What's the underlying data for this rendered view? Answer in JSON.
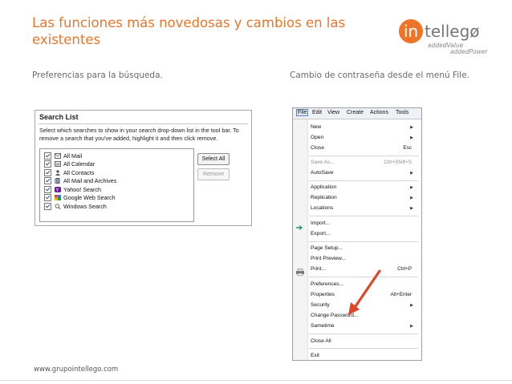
{
  "title": "Las funciones más novedosas y cambios en las existentes",
  "logo": {
    "word": "intellego",
    "tag1": "addedValue",
    "tag2": "addedPower",
    "brand_color": "#ee7428"
  },
  "captions": {
    "left": "Preferencias para la búsqueda.",
    "right": "Cambio de contraseña desde el menú File."
  },
  "footer": "www.grupointellego.com",
  "search_list": {
    "title": "Search List",
    "description": "Select which searches to show in your search drop-down list in the tool bar. To remove a search that you've added, highlight it and then click remove.",
    "items": [
      {
        "label": "All Mail",
        "icon": "mail-icon",
        "checked": true
      },
      {
        "label": "All Calendar",
        "icon": "calendar-icon",
        "checked": true
      },
      {
        "label": "All Contacts",
        "icon": "contacts-icon",
        "checked": true
      },
      {
        "label": "All Mail and Archives",
        "icon": "archive-icon",
        "checked": true
      },
      {
        "label": "Yahoo! Search",
        "icon": "yahoo-icon",
        "checked": true
      },
      {
        "label": "Google Web Search",
        "icon": "google-icon",
        "checked": true
      },
      {
        "label": "Windows Search",
        "icon": "magnifier-icon",
        "checked": true
      }
    ],
    "select_all": "Select All",
    "remove": "Remove"
  },
  "file_menu": {
    "menubar": [
      "File",
      "Edit",
      "View",
      "Create",
      "Actions",
      "Tools"
    ],
    "items": [
      {
        "label": "New",
        "shortcut": "",
        "submenu": true,
        "disabled": false
      },
      {
        "label": "Open",
        "shortcut": "",
        "submenu": true,
        "disabled": false
      },
      {
        "label": "Close",
        "shortcut": "Esc",
        "submenu": false,
        "disabled": false
      },
      {
        "label": "Save As...",
        "shortcut": "Ctrl+Shift+S",
        "submenu": false,
        "disabled": true
      },
      {
        "label": "AutoSave",
        "shortcut": "",
        "submenu": true,
        "disabled": false
      },
      {
        "label": "Application",
        "shortcut": "",
        "submenu": true,
        "disabled": false
      },
      {
        "label": "Replication",
        "shortcut": "",
        "submenu": true,
        "disabled": false
      },
      {
        "label": "Locations",
        "shortcut": "",
        "submenu": true,
        "disabled": false
      },
      {
        "label": "Import...",
        "shortcut": "",
        "submenu": false,
        "disabled": false
      },
      {
        "label": "Export...",
        "shortcut": "",
        "submenu": false,
        "disabled": false
      },
      {
        "label": "Page Setup...",
        "shortcut": "",
        "submenu": false,
        "disabled": false
      },
      {
        "label": "Print Preview...",
        "shortcut": "",
        "submenu": false,
        "disabled": false
      },
      {
        "label": "Print...",
        "shortcut": "Ctrl+P",
        "submenu": false,
        "disabled": false
      },
      {
        "label": "Preferences...",
        "shortcut": "",
        "submenu": false,
        "disabled": false
      },
      {
        "label": "Properties",
        "shortcut": "Alt+Enter",
        "submenu": false,
        "disabled": false
      },
      {
        "label": "Security",
        "shortcut": "",
        "submenu": true,
        "disabled": false
      },
      {
        "label": "Change Password...",
        "shortcut": "",
        "submenu": false,
        "disabled": false
      },
      {
        "label": "Sametime",
        "shortcut": "",
        "submenu": true,
        "disabled": false
      },
      {
        "label": "Close All",
        "shortcut": "",
        "submenu": false,
        "disabled": false
      },
      {
        "label": "Exit",
        "shortcut": "",
        "submenu": false,
        "disabled": false
      }
    ],
    "arrow_color": "#e0452b"
  }
}
